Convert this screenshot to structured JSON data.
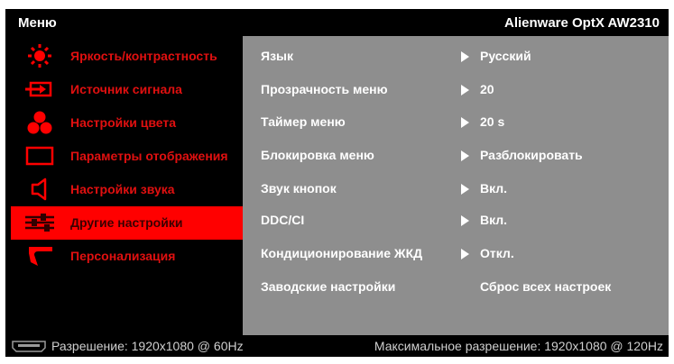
{
  "header": {
    "title": "Меню",
    "model": "Alienware OptX AW2310"
  },
  "menu": {
    "items": [
      {
        "label": "Яркость/контрастность",
        "icon": "brightness-icon"
      },
      {
        "label": "Источник сигнала",
        "icon": "input-source-icon"
      },
      {
        "label": "Настройки цвета",
        "icon": "color-icon"
      },
      {
        "label": "Параметры отображения",
        "icon": "display-icon"
      },
      {
        "label": "Настройки звука",
        "icon": "speaker-icon"
      },
      {
        "label": "Другие настройки",
        "icon": "sliders-icon",
        "selected": true
      },
      {
        "label": "Персонализация",
        "icon": "personalize-icon"
      }
    ]
  },
  "settings": {
    "rows": [
      {
        "name": "Язык",
        "value": "Русский",
        "arrow": true
      },
      {
        "name": "Прозрачность меню",
        "value": "20",
        "arrow": true
      },
      {
        "name": "Таймер меню",
        "value": "20 s",
        "arrow": true
      },
      {
        "name": "Блокировка меню",
        "value": "Разблокировать",
        "arrow": true
      },
      {
        "name": "Звук кнопок",
        "value": "Вкл.",
        "arrow": true
      },
      {
        "name": "DDC/CI",
        "value": "Вкл.",
        "arrow": true
      },
      {
        "name": "Кондиционирование ЖКД",
        "value": "Откл.",
        "arrow": true
      },
      {
        "name": "Заводские настройки",
        "value": "Сброс всех настроек",
        "arrow": false
      }
    ]
  },
  "footer": {
    "resolution": "Разрешение: 1920x1080 @ 60Hz",
    "max_resolution": "Максимальное разрешение: 1920x1080 @ 120Hz",
    "icon": "hdmi-connector-icon"
  },
  "colors": {
    "accent_red": "#ff0000",
    "menu_text_red": "#e01010",
    "panel_gray": "#8e8e8e",
    "background": "#000000"
  }
}
